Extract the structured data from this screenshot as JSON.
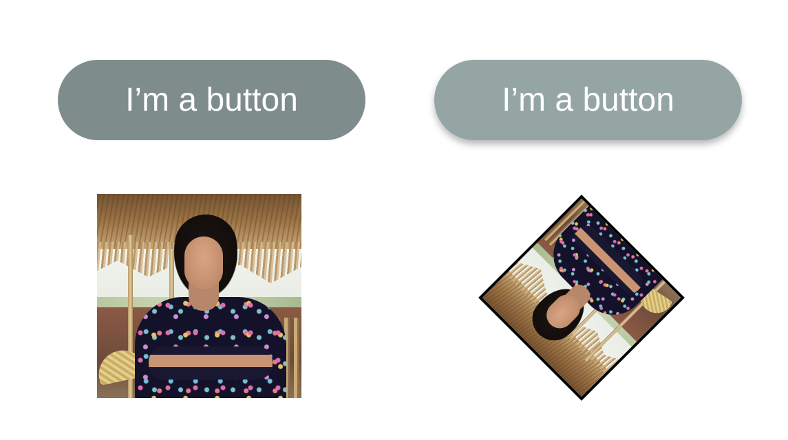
{
  "buttons": {
    "flat_label": "I’m a button",
    "raised_label": "I’m a button"
  },
  "colors": {
    "flat_button": "#7f8c8c",
    "raised_button": "#94a5a4",
    "button_text": "#ffffff",
    "diamond_border": "#000000"
  },
  "images": {
    "plain": "photo-portrait",
    "rotated": "photo-portrait-rotated-diamond"
  }
}
